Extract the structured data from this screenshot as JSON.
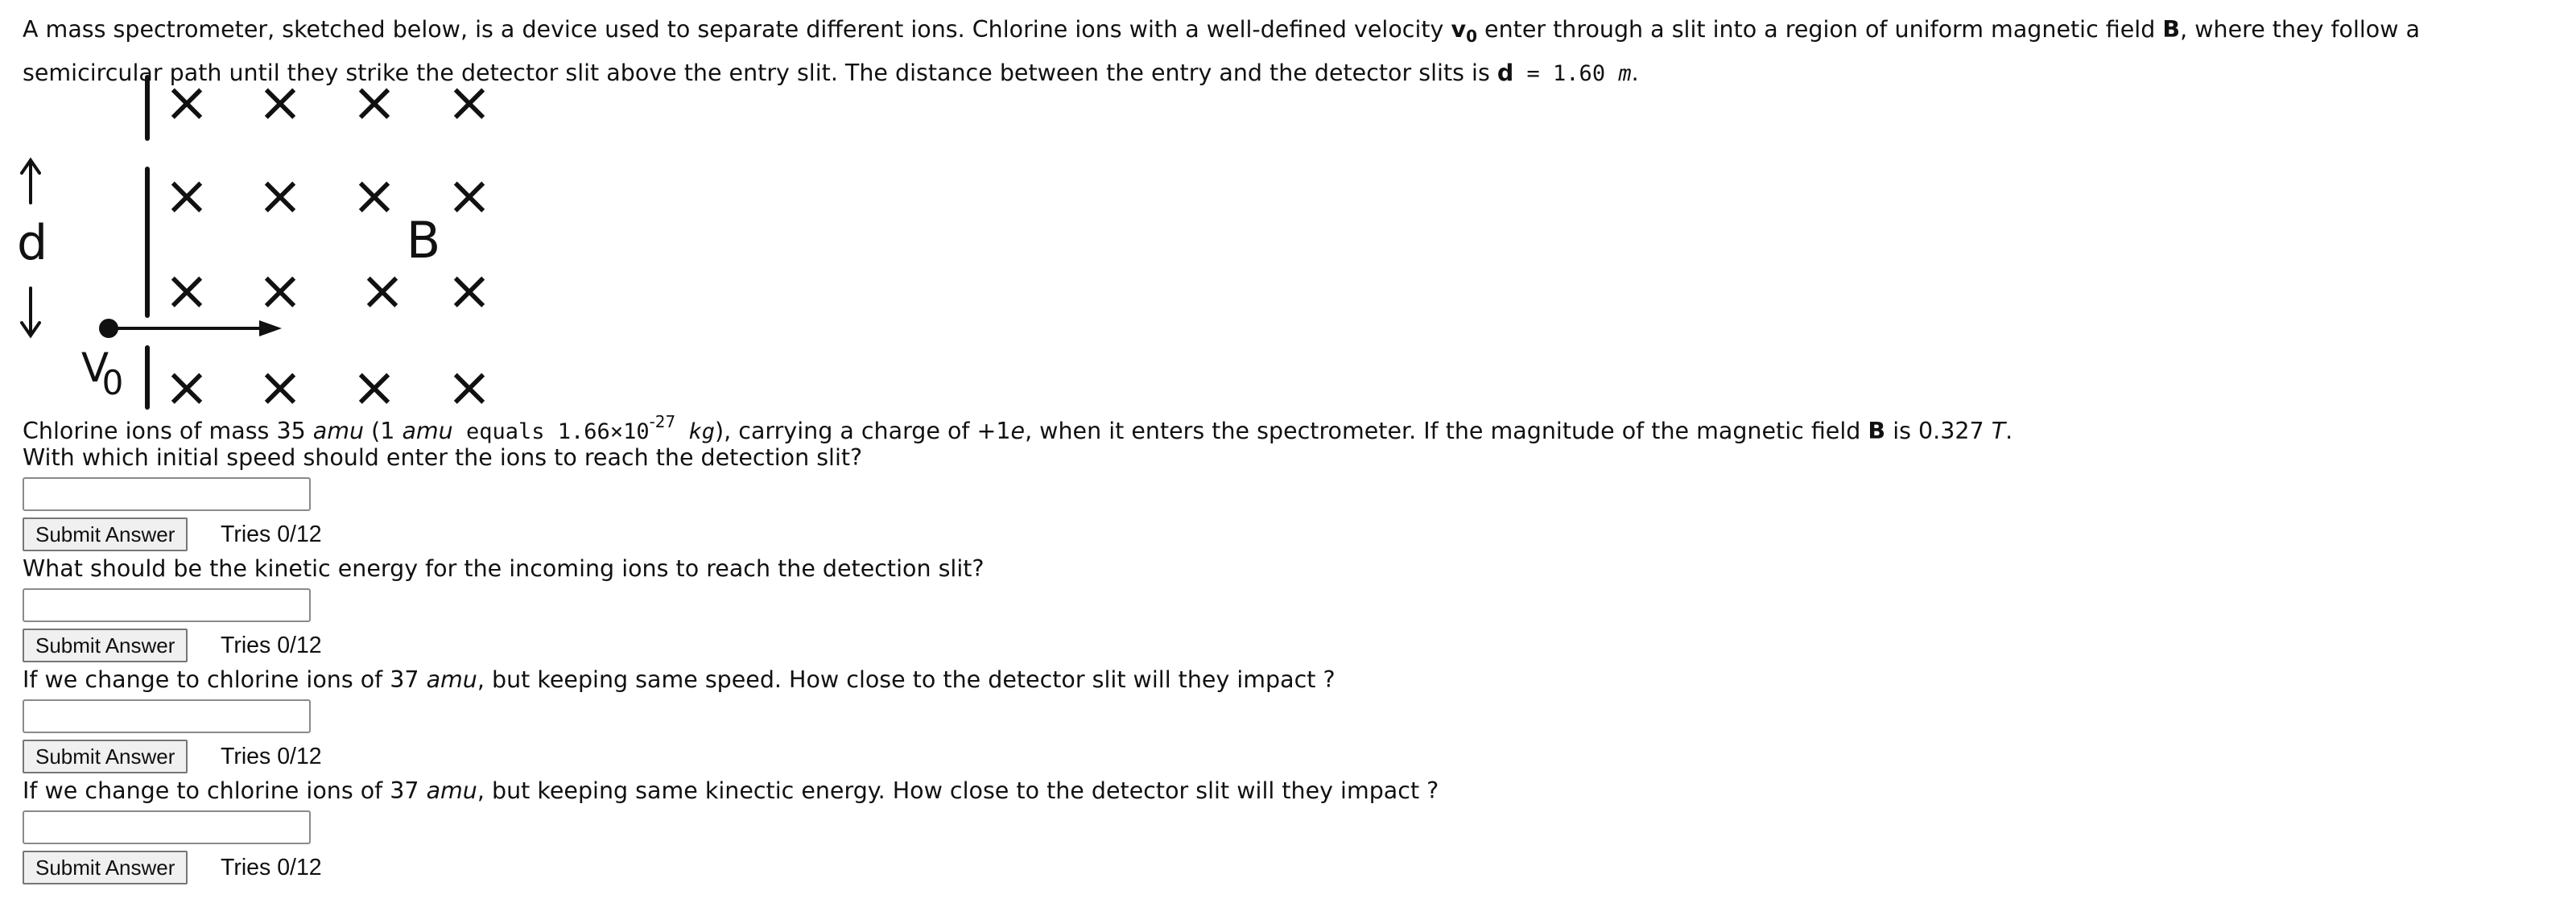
{
  "intro": {
    "p1": "A mass spectrometer, sketched below, is a device used to separate different ions. Chlorine ions with a well-defined velocity ",
    "v0_label": "v",
    "v0_sub": "0",
    "p2": " enter through a slit into a region of uniform magnetic field ",
    "field_symbol": "B",
    "p3": ", where they follow a semicircular path until they strike the detector slit above the entry slit. The distance between the entry and the detector slits is ",
    "d_symbol": "d",
    "eq": " = 1.60 ",
    "unit": "m",
    "end": "."
  },
  "diagram": {
    "cross": "×",
    "field_label": "B",
    "d_label": "d",
    "v_label": "V",
    "v_sub": "0"
  },
  "given": {
    "a": "Chlorine ions of mass 35 ",
    "amu1": "amu",
    "b": " (1 ",
    "amu2": "amu",
    "c": " equals 1.66×10",
    "exp": "-27",
    "kg": " kg",
    "d": "), carrying a charge of +1",
    "e": "e",
    "f": ", when it enters the spectrometer. If the magnitude of the magnetic field ",
    "B": "B",
    "g": " is 0.327 ",
    "T": "T",
    "h": "."
  },
  "questions": [
    {
      "text_a": "With which initial speed should enter the ions to reach the detection slit?",
      "unit": "",
      "text_b": "",
      "value": "",
      "submit": "Submit Answer",
      "tries": "Tries 0/12"
    },
    {
      "text_a": "What should be the kinetic energy for the incoming ions to reach the detection slit?",
      "unit": "",
      "text_b": "",
      "value": "",
      "submit": "Submit Answer",
      "tries": "Tries 0/12"
    },
    {
      "text_a": "If we change to chlorine ions of 37 ",
      "unit": "amu",
      "text_b": ", but keeping same speed. How close to the detector slit will they impact ?",
      "value": "",
      "submit": "Submit Answer",
      "tries": "Tries 0/12"
    },
    {
      "text_a": "If we change to chlorine ions of 37 ",
      "unit": "amu",
      "text_b": ", but keeping same kinectic energy. How close to the detector slit will they impact ?",
      "value": "",
      "submit": "Submit Answer",
      "tries": "Tries 0/12"
    }
  ]
}
